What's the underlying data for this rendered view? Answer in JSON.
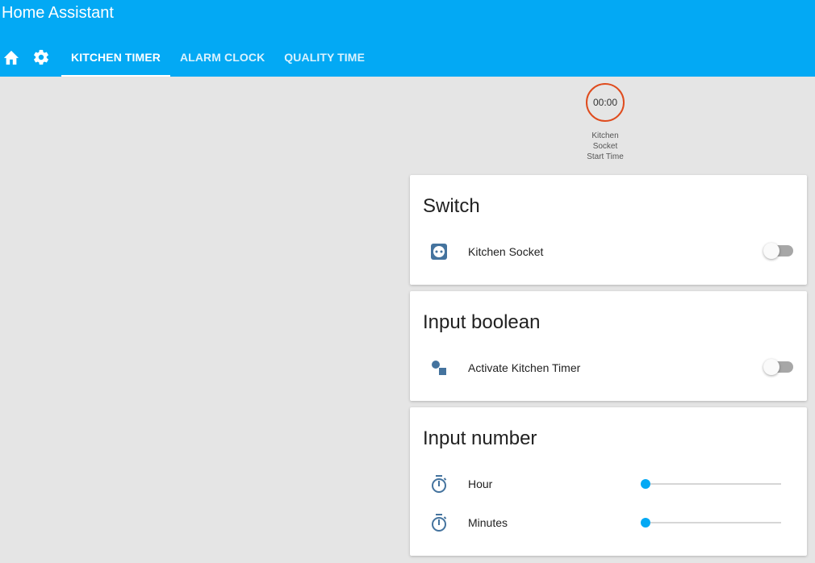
{
  "header": {
    "title": "Home Assistant",
    "home_icon": "home-icon",
    "settings_icon": "gear-icon",
    "tabs": [
      {
        "label": "KITCHEN TIMER",
        "active": true
      },
      {
        "label": "ALARM CLOCK",
        "active": false
      },
      {
        "label": "QUALITY TIME",
        "active": false
      }
    ]
  },
  "badge": {
    "value": "00:00",
    "label_line1": "Kitchen",
    "label_line2": "Socket",
    "label_line3": "Start Time",
    "ring_color": "#df4c1e"
  },
  "cards": {
    "switch": {
      "title": "Switch",
      "rows": [
        {
          "label": "Kitchen Socket",
          "icon": "power-socket-icon",
          "state": "off"
        }
      ]
    },
    "input_boolean": {
      "title": "Input boolean",
      "rows": [
        {
          "label": "Activate Kitchen Timer",
          "icon": "shape-icon",
          "state": "off"
        }
      ]
    },
    "input_number": {
      "title": "Input number",
      "rows": [
        {
          "label": "Hour",
          "icon": "timer-icon",
          "value_fraction": 0
        },
        {
          "label": "Minutes",
          "icon": "timer-icon",
          "value_fraction": 0
        }
      ]
    }
  },
  "colors": {
    "header": "#03a9f4",
    "accent": "#03a9f4",
    "icon": "#44739e",
    "background": "#e5e5e5"
  }
}
